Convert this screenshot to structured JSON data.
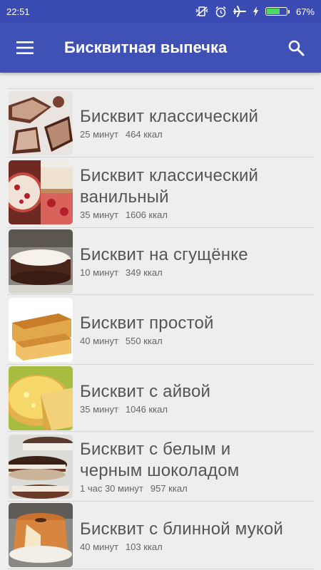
{
  "status": {
    "time": "22:51",
    "battery_percent": "67%",
    "battery_level": 0.67,
    "icons": [
      "vibrate-off-icon",
      "alarm-icon",
      "airplane-icon",
      "charging-icon",
      "battery-icon"
    ]
  },
  "appbar": {
    "title": "Бисквитная выпечка",
    "menu_icon": "hamburger-menu-icon",
    "search_icon": "search-icon",
    "color": "#3f51b5",
    "status_color": "#3b4bb4"
  },
  "recipes": [
    {
      "name": "Бисквит классический",
      "time": "25 минут",
      "calories": "464 ккал",
      "image": "chocolate-sponge-photo"
    },
    {
      "name": "Бисквит классический ванильный",
      "time": "35 минут",
      "calories": "1606 ккал",
      "image": "berry-sponge-photo"
    },
    {
      "name": "Бисквит на сгущёнке",
      "time": "10 минут",
      "calories": "349 ккал",
      "image": "chocolate-cake-photo"
    },
    {
      "name": "Бисквит простой",
      "time": "40 минут",
      "calories": "550 ккал",
      "image": "plain-sponge-photo"
    },
    {
      "name": "Бисквит с айвой",
      "time": "35 минут",
      "calories": "1046 ккал",
      "image": "quince-sponge-photo"
    },
    {
      "name": "Бисквит с белым и черным шоколадом",
      "time": "1 час 30 минут",
      "calories": "957 ккал",
      "image": "chocolate-layer-cake-photo"
    },
    {
      "name": "Бисквит с блинной мукой",
      "time": "40 минут",
      "calories": "103 ккал",
      "image": "bundt-cake-photo"
    }
  ]
}
